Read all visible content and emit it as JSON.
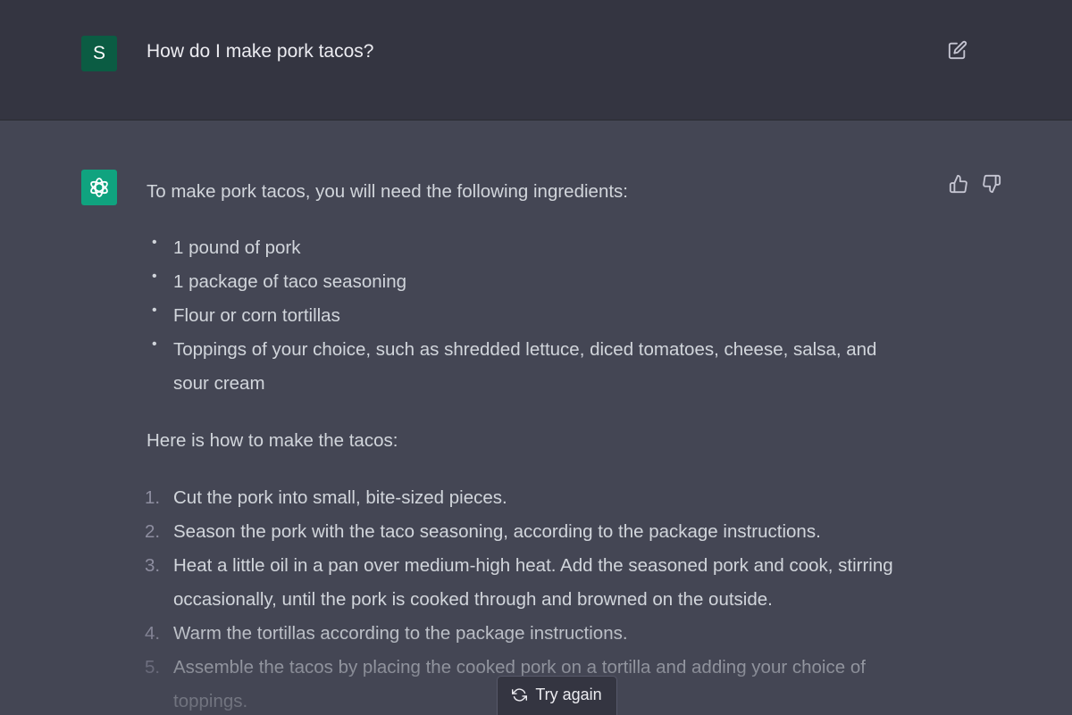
{
  "user_turn": {
    "avatar_letter": "S",
    "message": "How do I make pork tacos?"
  },
  "assistant_turn": {
    "intro": "To make pork tacos, you will need the following ingredients:",
    "ingredients": [
      "1 pound of pork",
      "1 package of taco seasoning",
      "Flour or corn tortillas",
      "Toppings of your choice, such as shredded lettuce, diced tomatoes, cheese, salsa, and sour cream"
    ],
    "howto": "Here is how to make the tacos:",
    "steps": [
      {
        "num": "1.",
        "text": "Cut the pork into small, bite-sized pieces."
      },
      {
        "num": "2.",
        "text": "Season the pork with the taco seasoning, according to the package instructions."
      },
      {
        "num": "3.",
        "text": "Heat a little oil in a pan over medium-high heat. Add the seasoned pork and cook, stirring occasionally, until the pork is cooked through and browned on the outside."
      },
      {
        "num": "4.",
        "text": "Warm the tortillas according to the package instructions."
      },
      {
        "num": "5.",
        "text": "Assemble the tacos by placing the cooked pork on a tortilla and adding your choice of toppings."
      }
    ]
  },
  "actions": {
    "try_again_label": "Try again"
  },
  "icons": {
    "edit": "edit-icon",
    "thumbs_up": "thumbs-up-icon",
    "thumbs_down": "thumbs-down-icon",
    "regenerate": "regenerate-icon",
    "assistant_logo": "openai-logo-icon"
  },
  "colors": {
    "user_avatar": "#0b5c43",
    "assistant_avatar": "#10a37f",
    "user_row_bg": "#343541",
    "assistant_row_bg": "#444654"
  }
}
